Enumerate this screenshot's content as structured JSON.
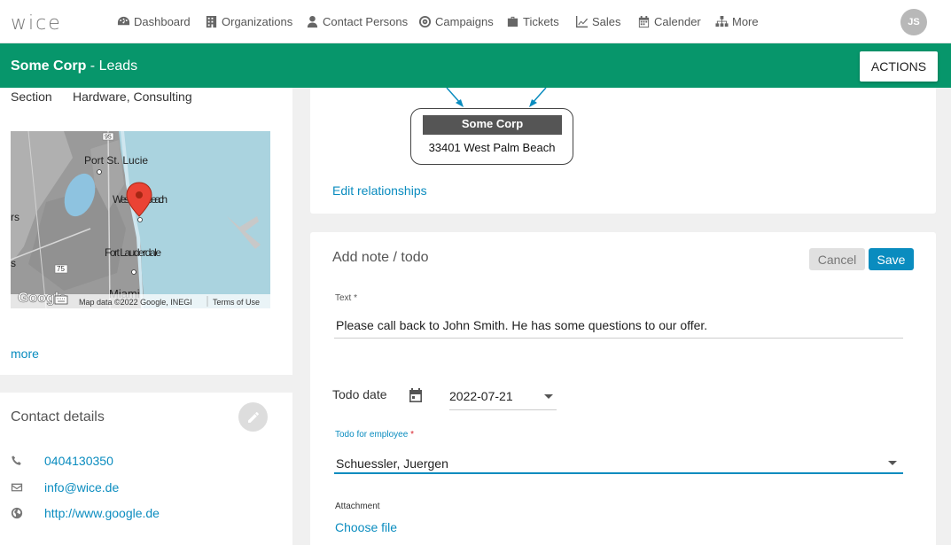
{
  "app": {
    "logo": "wice"
  },
  "nav": {
    "items": [
      {
        "label": "Dashboard",
        "icon": "dashboard-icon"
      },
      {
        "label": "Organizations",
        "icon": "building-icon"
      },
      {
        "label": "Contact Persons",
        "icon": "person-icon"
      },
      {
        "label": "Campaigns",
        "icon": "target-icon"
      },
      {
        "label": "Tickets",
        "icon": "briefcase-icon"
      },
      {
        "label": "Sales",
        "icon": "chart-line-icon"
      },
      {
        "label": "Calender",
        "icon": "calendar-icon"
      },
      {
        "label": "More",
        "icon": "sitemap-icon"
      }
    ],
    "user_initials": "JS"
  },
  "header": {
    "org_name": "Some Corp",
    "suffix": " - Leads",
    "actions_label": "ACTIONS",
    "color": "#07966b"
  },
  "details": {
    "section_label": "Section",
    "section_value": "Hardware, Consulting",
    "more_label": "more"
  },
  "map": {
    "labels": [
      "Port St. Lucie",
      "West Palm Beach",
      "Fort Lauderdale",
      "Miami",
      "95",
      "75",
      "rs",
      "s"
    ],
    "attribution": "Map data ©2022 Google, INEGI",
    "terms": "Terms of Use",
    "google": "Google"
  },
  "contact": {
    "title": "Contact details",
    "phone": "0404130350",
    "email": "info@wice.de",
    "website": "http://www.google.de"
  },
  "relationships": {
    "org_title": "Some Corp",
    "org_address": "33401 West Palm Beach",
    "edit_label": "Edit relationships"
  },
  "note": {
    "title": "Add note / todo",
    "cancel_label": "Cancel",
    "save_label": "Save",
    "text_label": "Text",
    "text_value": "Please call back to John Smith. He has some questions to our offer.",
    "todo_date_label": "Todo date",
    "todo_date_value": "2022-07-21",
    "employee_label": "Todo for employee",
    "employee_value": "Schuessler, Juergen",
    "attachment_label": "Attachment",
    "choose_file_label": "Choose file",
    "required_mark": "*"
  },
  "colors": {
    "accent": "#0a8cbf",
    "primary_green": "#07966b"
  }
}
